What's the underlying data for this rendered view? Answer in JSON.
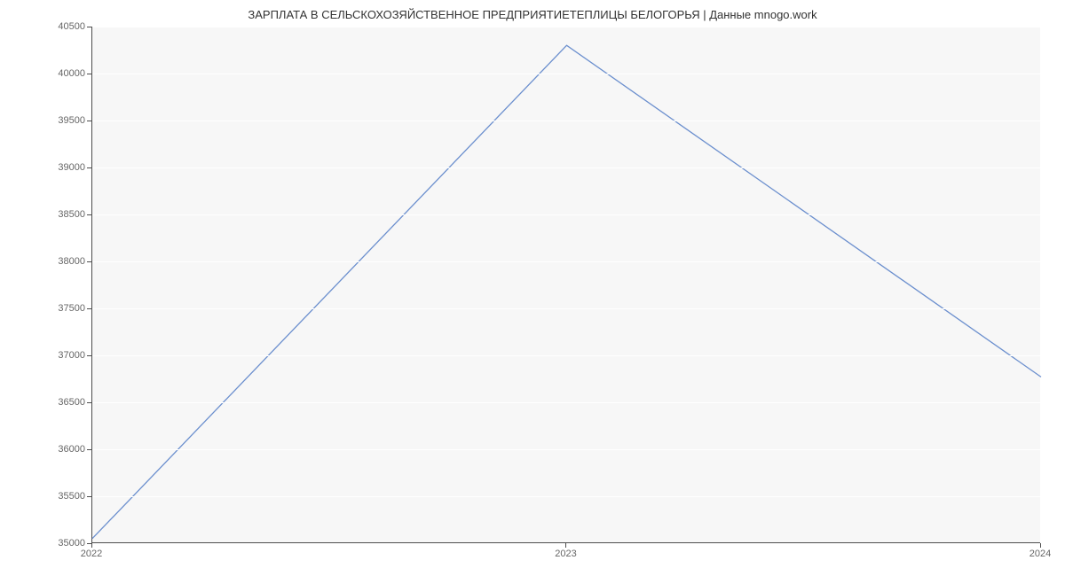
{
  "chart_data": {
    "type": "line",
    "title": "ЗАРПЛАТА В  СЕЛЬСКОХОЗЯЙСТВЕННОЕ ПРЕДПРИЯТИЕТЕПЛИЦЫ БЕЛОГОРЬЯ | Данные mnogo.work",
    "x": [
      "2022",
      "2023",
      "2024"
    ],
    "values": [
      35000,
      40300,
      36770
    ],
    "y_ticks": [
      35000,
      35500,
      36000,
      36500,
      37000,
      37500,
      38000,
      38500,
      39000,
      39500,
      40000,
      40500
    ],
    "ylim": [
      35000,
      40500
    ],
    "on_y_axis": 35050,
    "xlabel": "",
    "ylabel": ""
  }
}
